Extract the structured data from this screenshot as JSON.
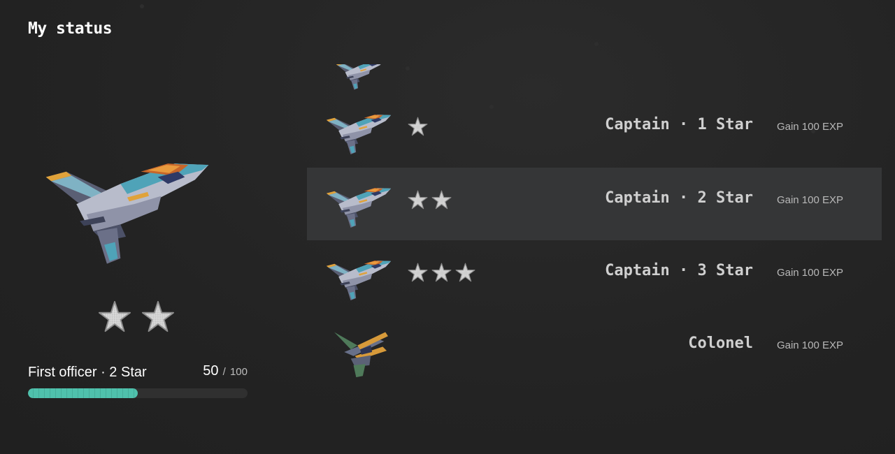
{
  "header": {
    "title": "My status"
  },
  "current": {
    "rank_name": "First officer · 2 Star",
    "stars": 2,
    "exp_current": "50",
    "exp_separator": "/",
    "exp_max": "100",
    "progress_fraction": 0.5,
    "ship_icon": "fighter-jet-icon"
  },
  "ranks": [
    {
      "name": "Captain · 1 Star",
      "stars": 1,
      "gain": "Gain 100 EXP",
      "ship_icon": "fighter-jet-icon",
      "selected": false
    },
    {
      "name": "Captain · 2 Star",
      "stars": 2,
      "gain": "Gain 100 EXP",
      "ship_icon": "fighter-jet-icon",
      "selected": true
    },
    {
      "name": "Captain · 3 Star",
      "stars": 3,
      "gain": "Gain 100 EXP",
      "ship_icon": "fighter-jet-icon",
      "selected": false
    },
    {
      "name": "Colonel",
      "stars": 0,
      "gain": "Gain 100 EXP",
      "ship_icon": "interceptor-ship-icon",
      "selected": false
    }
  ],
  "colors": {
    "background": "#252525",
    "progress_fill": "#4fc1ac",
    "selected_row": "#353637",
    "star": "#d9d9d9"
  }
}
